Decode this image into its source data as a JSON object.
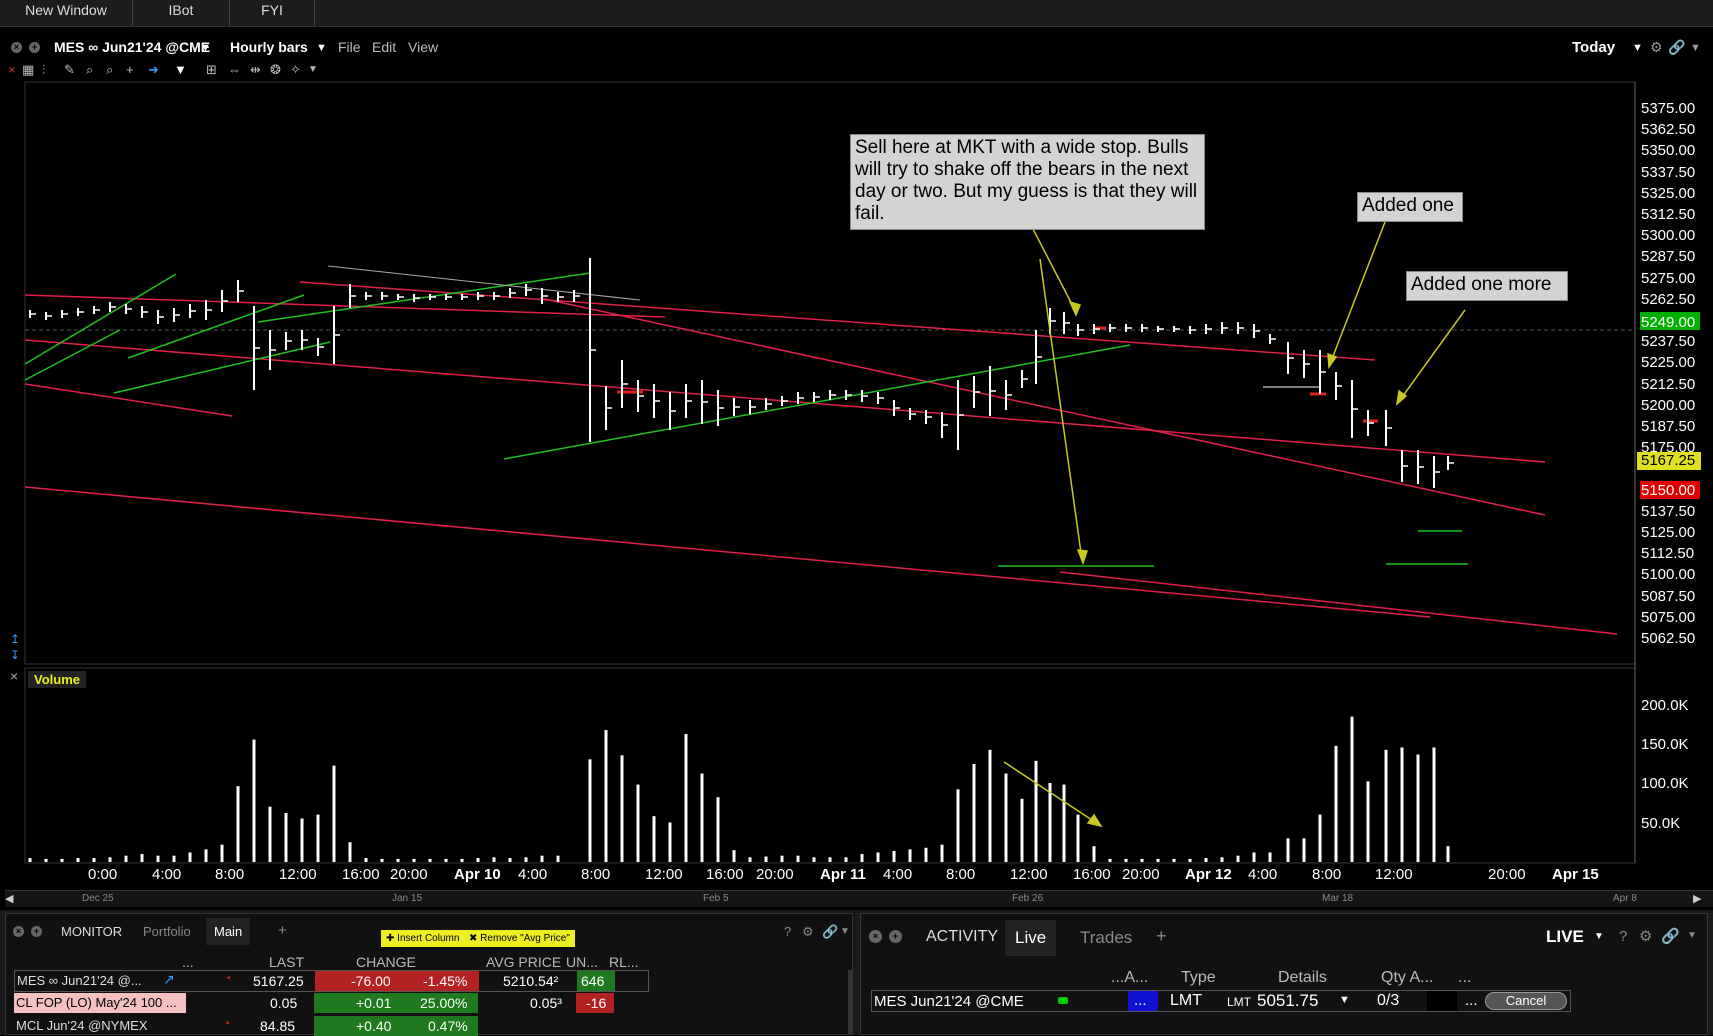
{
  "top_tabs": [
    "New Window",
    "IBot",
    "FYI"
  ],
  "header": {
    "symbol": "MES ∞ Jun21'24 @CME",
    "bar_type": "Hourly bars",
    "menu": [
      "File",
      "Edit",
      "View"
    ],
    "period": "Today"
  },
  "chart": {
    "price_ticks": [
      "5375.00",
      "5362.50",
      "5350.00",
      "5337.50",
      "5325.00",
      "5312.50",
      "5300.00",
      "5287.50",
      "5275.00",
      "5262.50",
      "5249.00",
      "5237.50",
      "5225.00",
      "5212.50",
      "5200.00",
      "5187.50",
      "5175.00",
      "5167.25",
      "5150.00",
      "5137.50",
      "5125.00",
      "5112.50",
      "5100.00",
      "5087.50",
      "5075.00",
      "5062.50"
    ],
    "tag_current": "5249.00",
    "tag_last": "5167.25",
    "tag_red": "5150.00",
    "annotations": {
      "sell": "Sell here at MKT with a wide stop. Bulls will try to shake off the bears in the next day or two. But my guess is that they will fail.",
      "added_one": "Added one",
      "added_one_more": "Added one more"
    },
    "volume_label": "Volume",
    "volume_ticks": [
      "200.0K",
      "150.0K",
      "100.0K",
      "50.0K"
    ],
    "time_ticks": [
      "0:00",
      "4:00",
      "8:00",
      "12:00",
      "16:00",
      "20:00",
      "Apr 10",
      "4:00",
      "8:00",
      "12:00",
      "16:00",
      "20:00",
      "Apr 11",
      "4:00",
      "8:00",
      "12:00",
      "16:00",
      "20:00",
      "Apr 12",
      "4:00",
      "8:00",
      "12:00",
      "20:00",
      "Apr 15"
    ],
    "overview_ticks": [
      "Dec 25",
      "Jan 15",
      "Feb 5",
      "Feb 26",
      "Mar 18",
      "Apr 8"
    ]
  },
  "monitor": {
    "tabs": [
      "MONITOR",
      "Portfolio",
      "Main"
    ],
    "tooltip_insert": "Insert Column",
    "tooltip_remove": "Remove \"Avg Price\"",
    "columns": [
      "...",
      "LAST",
      "CHANGE",
      "AVG PRICE",
      "UN...",
      "RL..."
    ],
    "rows": [
      {
        "name": "MES ∞ Jun21'24 @...",
        "last": "5167.25",
        "chg": "-76.00",
        "pct": "-1.45%",
        "avg": "5210.54²",
        "un": "646"
      },
      {
        "name": "CL FOP (LO) May'24 100 ...",
        "last": "0.05",
        "chg": "+0.01",
        "pct": "25.00%",
        "avg": "0.05³",
        "un": "-16"
      },
      {
        "name": "MCL Jun'24 @NYMEX",
        "last": "84.85",
        "chg": "+0.40",
        "pct": "0.47%",
        "avg": "",
        "un": ""
      }
    ]
  },
  "activity": {
    "tabs": [
      "ACTIVITY",
      "Live",
      "Trades"
    ],
    "mode": "LIVE",
    "columns": [
      "...A...",
      "Type",
      "Details",
      "Qty A...",
      "..."
    ],
    "order": {
      "name": "MES Jun21'24 @CME",
      "action": "...",
      "type": "LMT",
      "details_type": "LMT",
      "details_price": "5051.75",
      "qty": "0/3",
      "more": "...",
      "cancel": "Cancel"
    }
  },
  "colors": {
    "up": "#1f7a1f",
    "down": "#b22222",
    "green_tag": "#00b000",
    "yellow_tag": "#e0e020",
    "red_tag": "#e00000"
  }
}
